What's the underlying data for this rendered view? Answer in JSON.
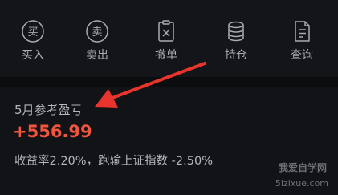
{
  "toolbar": {
    "buy": {
      "icon_char": "买",
      "label": "买入"
    },
    "sell": {
      "icon_char": "卖",
      "label": "卖出"
    },
    "cancel": {
      "label": "撤单"
    },
    "holdings": {
      "label": "持仓"
    },
    "query": {
      "label": "查询"
    }
  },
  "pnl": {
    "title": "5月参考盈亏",
    "value": "+556.99",
    "summary": "收益率2.20%，跑输上证指数 -2.50%"
  },
  "watermark": {
    "line1": "我爱自学网",
    "line2": "5izixue.com"
  },
  "colors": {
    "profit": "#f2553d",
    "arrow": "#e8342d"
  }
}
